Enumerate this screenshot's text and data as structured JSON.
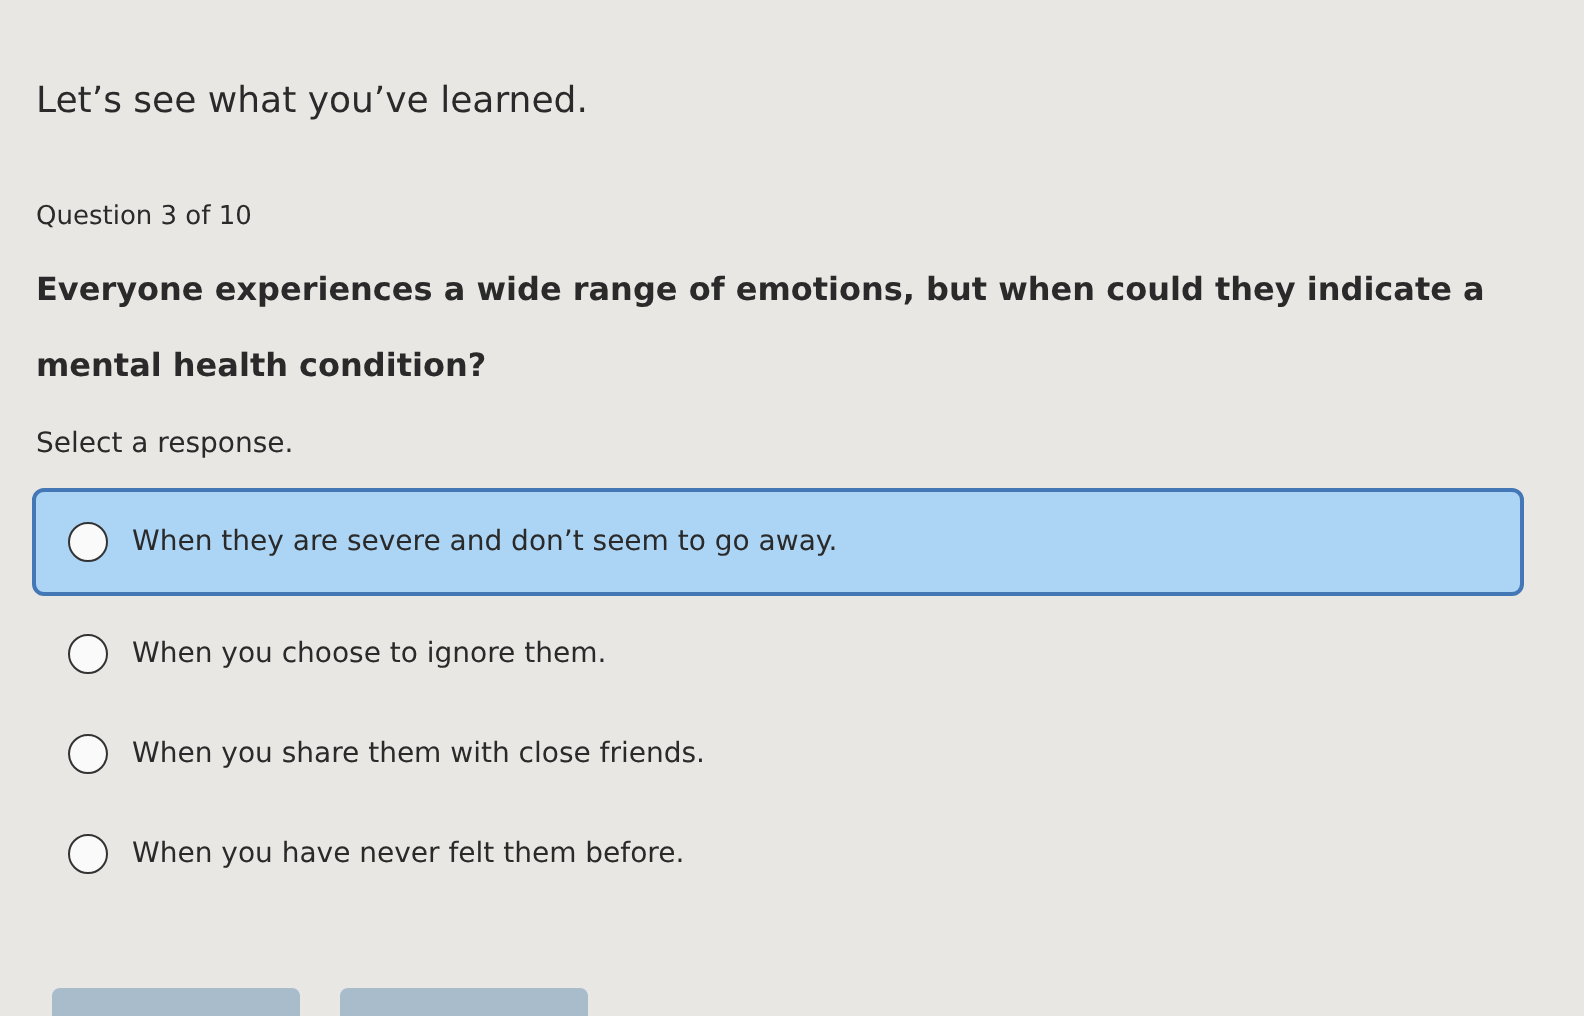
{
  "intro": "Let’s see what you’ve learned.",
  "progress": "Question 3 of 10",
  "question": "Everyone experiences a wide range of emotions, but when could they indicate a mental health condition?",
  "instruction": "Select a response.",
  "options": [
    {
      "label": "When they are severe and don’t seem to go away.",
      "selected": true
    },
    {
      "label": "When you choose to ignore them.",
      "selected": false
    },
    {
      "label": "When you share them with close friends.",
      "selected": false
    },
    {
      "label": "When you have never felt them before.",
      "selected": false
    }
  ],
  "footer_buttons": [
    {
      "kind": "button"
    },
    {
      "kind": "button"
    }
  ]
}
